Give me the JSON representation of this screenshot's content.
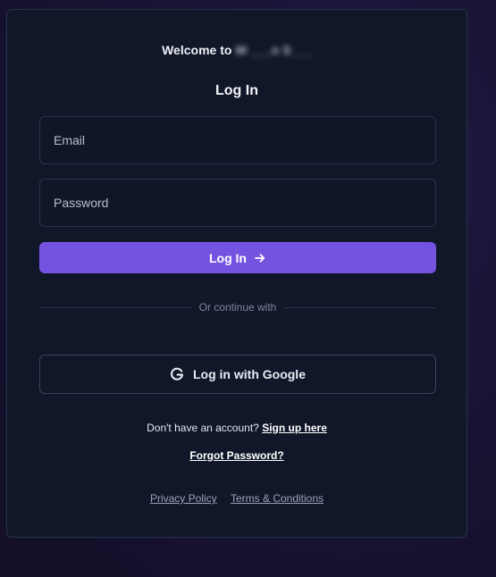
{
  "header": {
    "welcome_prefix": "Welcome to",
    "welcome_app_name": "W ___n S _ _",
    "title": "Log In"
  },
  "form": {
    "email_placeholder": "Email",
    "password_placeholder": "Password",
    "submit_label": "Log In",
    "submit_icon": "arrow-right-icon"
  },
  "divider": {
    "text": "Or continue with"
  },
  "social": {
    "google_label": "Log in with Google",
    "google_icon": "google-icon"
  },
  "signup": {
    "prompt": "Don't have an account?",
    "link_label": "Sign up here"
  },
  "forgot": {
    "label": "Forgot Password?"
  },
  "footer": {
    "privacy_label": "Privacy Policy",
    "terms_label": "Terms & Conditions"
  },
  "colors": {
    "accent": "#7553e1",
    "card_background": "#101729",
    "page_background": "#1a1436"
  }
}
